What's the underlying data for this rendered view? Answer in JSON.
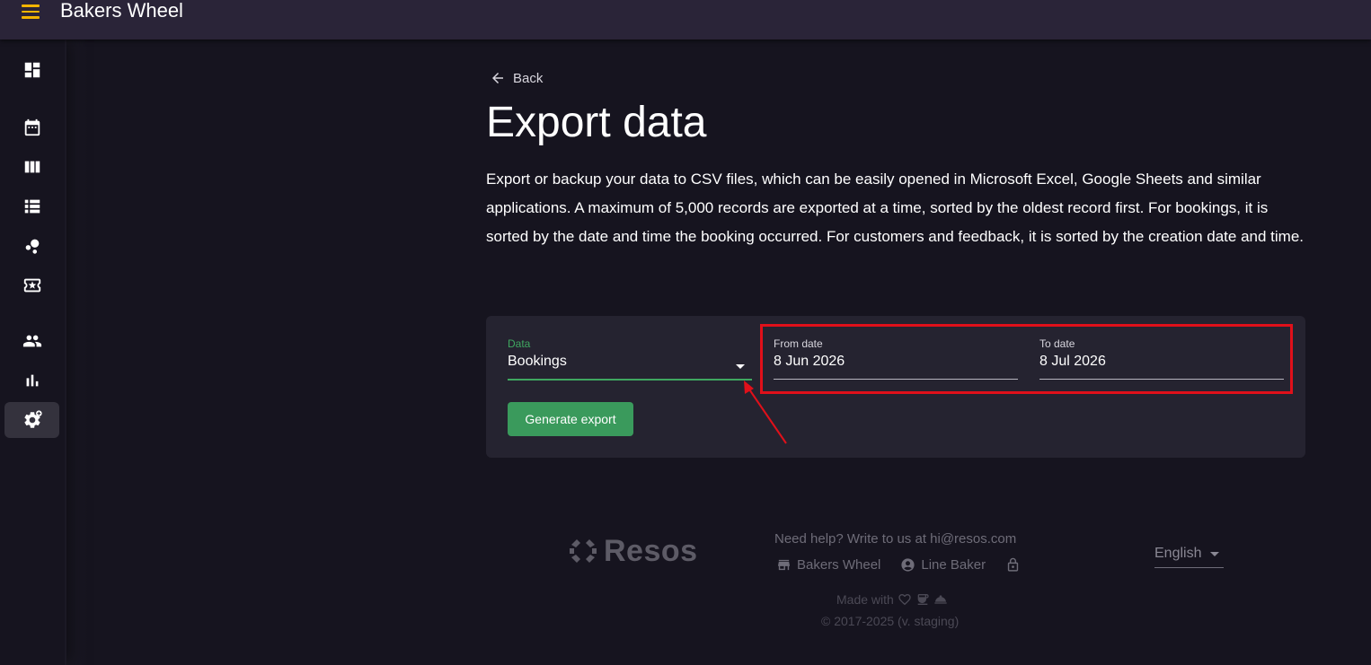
{
  "header": {
    "app_title": "Bakers Wheel",
    "menu_icon": "hamburger-menu-icon",
    "accent_color": "#f2b400"
  },
  "sidebar": {
    "items": [
      {
        "icon": "dashboard-icon",
        "active": false
      },
      {
        "icon": "calendar-icon",
        "active": false
      },
      {
        "icon": "columns-view-icon",
        "active": false
      },
      {
        "icon": "list-view-icon",
        "active": false
      },
      {
        "icon": "bubbles-icon",
        "active": false
      },
      {
        "icon": "ticket-star-icon",
        "active": false
      },
      {
        "icon": "people-icon",
        "active": false
      },
      {
        "icon": "bar-chart-icon",
        "active": false
      },
      {
        "icon": "settings-gear-icon",
        "active": true
      }
    ]
  },
  "main": {
    "back_label": "Back",
    "title": "Export data",
    "description": "Export or backup your data to CSV files, which can be easily opened in Microsoft Excel, Google Sheets and similar applications. A maximum of 5,000 records are exported at a time, sorted by the oldest record first. For bookings, it is sorted by the date and time the booking occurred. For customers and feedback, it is sorted by the creation date and time."
  },
  "export_form": {
    "data_label": "Data",
    "data_value": "Bookings",
    "from_label": "From date",
    "from_value": "8 Jun 2026",
    "to_label": "To date",
    "to_value": "8 Jul 2026",
    "generate_label": "Generate export",
    "button_color": "#3a9a5c",
    "annotation_color": "#e0101a"
  },
  "footer": {
    "logo_text": "Resos",
    "help_text": "Need help? Write to us at hi@resos.com",
    "restaurant_name": "Bakers Wheel",
    "user_name": "Line Baker",
    "language": "English",
    "made_with": "Made with",
    "copyright": "© 2017-2025 (v. staging)"
  }
}
